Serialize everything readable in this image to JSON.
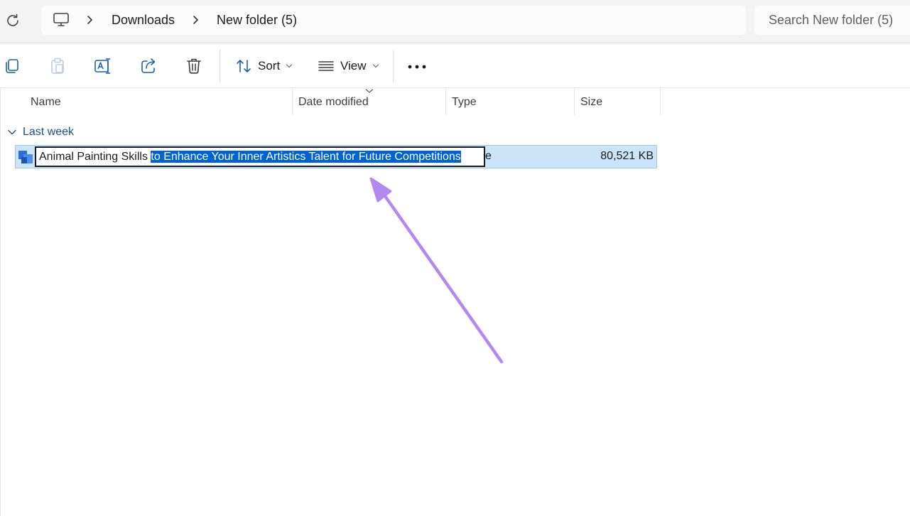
{
  "address_bar": {
    "breadcrumbs": [
      "Downloads",
      "New folder (5)"
    ],
    "search_placeholder": "Search New folder (5)"
  },
  "command_bar": {
    "sort_label": "Sort",
    "view_label": "View"
  },
  "columns": [
    "Name",
    "Date modified",
    "Type",
    "Size"
  ],
  "group": {
    "label": "Last week"
  },
  "file": {
    "name_unselected": "Animal Painting Skills ",
    "name_selected": "to Enhance Your Inner Artistics Talent for Future Competitions",
    "type_fragment": "e",
    "size": "80,521 KB"
  },
  "colors": {
    "selection_highlight": "#0063d1",
    "row_selected": "#cce4f7",
    "annotation_arrow": "#b388f0"
  }
}
